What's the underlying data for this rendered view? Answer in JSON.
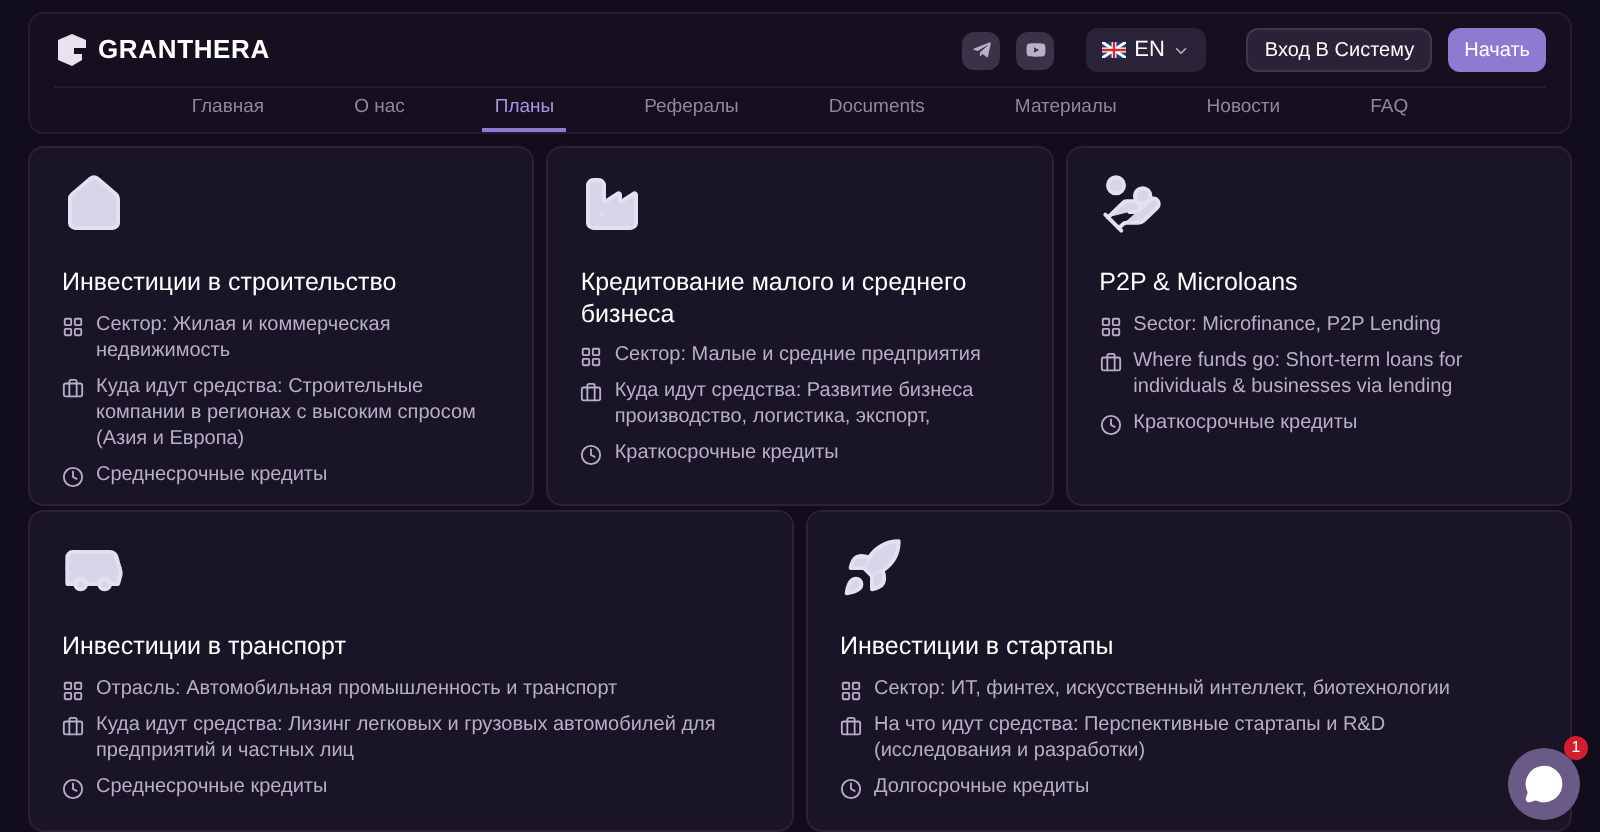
{
  "header": {
    "brand": "GRANTHERA",
    "language": "EN",
    "login": "Вход В Систему",
    "start": "Начать"
  },
  "nav": [
    {
      "label": "Главная",
      "selected": false
    },
    {
      "label": "О нас",
      "selected": false
    },
    {
      "label": "Планы",
      "selected": true
    },
    {
      "label": "Рефералы",
      "selected": false
    },
    {
      "label": "Documents",
      "selected": false
    },
    {
      "label": "Материалы",
      "selected": false
    },
    {
      "label": "Новости",
      "selected": false
    },
    {
      "label": "FAQ",
      "selected": false
    }
  ],
  "cards": [
    {
      "title": "Инвестиции в строительство",
      "items": [
        {
          "kind": "sector",
          "text": "Сектор: Жилая и коммерческая недвижимость"
        },
        {
          "kind": "funds",
          "text": "Куда идут средства: Строительные компании в регионах с высоким спросом (Азия и Европа)"
        },
        {
          "kind": "term",
          "text": "Среднесрочные кредиты"
        }
      ]
    },
    {
      "title": "Кредитование малого и среднего бизнеса",
      "items": [
        {
          "kind": "sector",
          "text": "Сектор: Малые и средние предприятия"
        },
        {
          "kind": "funds",
          "text": "Куда идут средства: Развитие бизнеса производство, логистика, экспорт,"
        },
        {
          "kind": "term",
          "text": "Краткосрочные кредиты"
        }
      ]
    },
    {
      "title": "P2P & Microloans",
      "items": [
        {
          "kind": "sector",
          "text": "Sector: Microfinance, P2P Lending"
        },
        {
          "kind": "funds",
          "text": "Where funds go: Short-term loans for individuals & businesses via lending"
        },
        {
          "kind": "term",
          "text": "Краткосрочные кредиты"
        }
      ]
    },
    {
      "title": "Инвестиции в транспорт",
      "items": [
        {
          "kind": "sector",
          "text": "Отрасль: Автомобильная промышленность и транспорт"
        },
        {
          "kind": "funds",
          "text": "Куда идут средства: Лизинг легковых и грузовых автомобилей для предприятий и частных лиц"
        },
        {
          "kind": "term",
          "text": "Среднесрочные кредиты"
        }
      ]
    },
    {
      "title": "Инвестиции в стартапы",
      "items": [
        {
          "kind": "sector",
          "text": "Сектор: ИТ, финтех, искусственный интеллект, биотехнологии"
        },
        {
          "kind": "funds",
          "text": "На что идут средства: Перспективные стартапы и R&D (исследования и разработки)"
        },
        {
          "kind": "term",
          "text": "Долгосрочные кредиты"
        }
      ]
    }
  ],
  "chat": {
    "badge": "1"
  }
}
